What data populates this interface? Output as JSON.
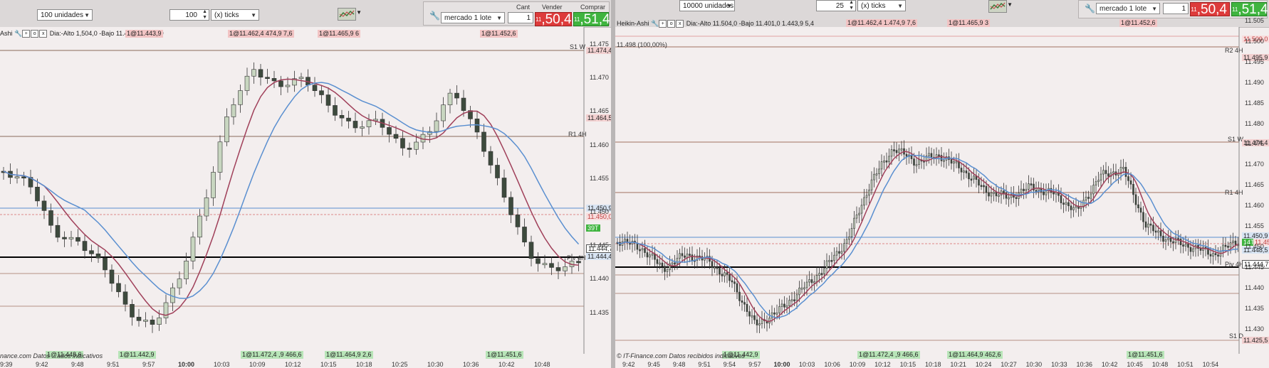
{
  "colors": {
    "sell": "#dd3b3b",
    "buy": "#3fb43f",
    "ma_red": "#a0405a",
    "ma_blue": "#5a8fd0",
    "bull": "#c8d6c0",
    "bear": "#3d4a3d"
  },
  "left": {
    "toolbar": {
      "units": "100 unidades",
      "qty": "100",
      "mult": "(x) ticks",
      "order_type": "mercado 1 lote",
      "cant_label": "Cant",
      "cant_value": "1",
      "sell_label": "Vender",
      "buy_label": "Comprar",
      "sell_small": "11",
      "sell_big": ",50,4",
      "buy_small": "11",
      "buy_big": ",51,4"
    },
    "info": {
      "name": "Ashi",
      "text": "Dia:-Alto 1,504,0 -Bajo 11.401,0 1.443,9"
    },
    "tags": [
      "1@11.462,4 474,9 7,6",
      "1@11.465,9 6",
      "1@11.452,6"
    ],
    "bottom_tags": [
      "1@11.448,6",
      "1@11.442,9",
      "1@11.472,4 ,9 466,6",
      "1@11.464,9 2,6",
      "1@11.451,6"
    ],
    "footer": "nance.com  Datos ...ados indicativos",
    "yticks": [
      "11.475",
      "11.470",
      "11.465",
      "11.460",
      "11.455",
      "11.450",
      "11.445",
      "11.440",
      "11.435"
    ],
    "level_labels": [
      "S1 W",
      "R1 4H",
      "Piv 4H"
    ],
    "price_boxes": [
      "11.474,4",
      "11.464,5",
      "11.450,9",
      "11.450,0",
      "11.444,7",
      "11.444,4",
      "39T"
    ],
    "times": [
      "9:39",
      "9:42",
      "9:48",
      "9:51",
      "9:57",
      "10:00",
      "10:03",
      "10:09",
      "10:12",
      "10:15",
      "10:18",
      "10:25",
      "10:30",
      "10:36",
      "10:42",
      "10:48"
    ]
  },
  "right": {
    "toolbar": {
      "units": "10000 unidades",
      "qty": "25",
      "mult": "(x) ticks",
      "order_type": "mercado 1 lote",
      "cant_value": "1",
      "sell_small": "11",
      "sell_big": ",50,4",
      "buy_small": "11",
      "buy_big": ",51,4"
    },
    "info": {
      "name": "Heikin-Ashi",
      "text": "Dia:-Alto 11.504,0 -Bajo 11.401,0 1.443,9 5,4"
    },
    "range": "11.498 (100,00%)",
    "tags": [
      "1@11.462,4 1.474,9 7,6",
      "1@11.465,9 3",
      "1@11.452,6"
    ],
    "bottom_tags": [
      "1@11.442,9",
      "1@11.472,4 ,9 466,6",
      "1@11.464,9 462,6",
      "1@11.451,6"
    ],
    "footer": "© IT-Finance.com  Datos recibidos indicativos",
    "yticks": [
      "11.505",
      "11.500",
      "11.495",
      "11.490",
      "11.485",
      "11.480",
      "11.475",
      "11.470",
      "11.465",
      "11.460",
      "11.455",
      "11.450",
      "11.445",
      "11.440",
      "11.435",
      "11.430"
    ],
    "level_labels": [
      "R2 4H",
      "S1 W",
      "R1 4H",
      "Piv 4H",
      "S1 D"
    ],
    "price_boxes": [
      "11.509,0",
      "11.495,9",
      "11.474,4",
      "11.450,9",
      "14T",
      "11.450,0",
      "11.448,5",
      "11.444,7",
      "11.425,5"
    ],
    "times": [
      "9:42",
      "9:45",
      "9:48",
      "9:51",
      "9:54",
      "9:57",
      "10:00",
      "10:03",
      "10:06",
      "10:09",
      "10:12",
      "10:15",
      "10:18",
      "10:21",
      "10:24",
      "10:27",
      "10:30",
      "10:33",
      "10:36",
      "10:42",
      "10:45",
      "10:48",
      "10:51",
      "10:54"
    ]
  }
}
